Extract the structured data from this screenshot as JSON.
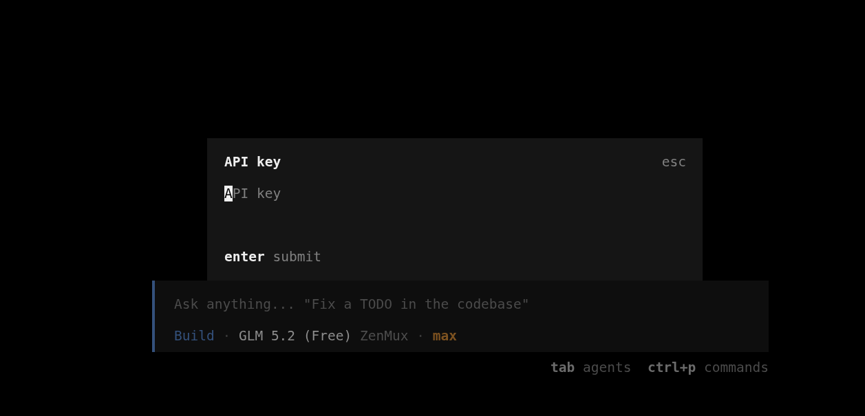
{
  "dialog": {
    "title": "API key",
    "close_hint": "esc",
    "field": {
      "placeholder": "API key",
      "focused": true
    },
    "hints": [
      {
        "key": "enter",
        "action": "submit"
      }
    ]
  },
  "prompt": {
    "placeholder": "Ask anything... \"Fix a TODO in the codebase\"",
    "status": [
      {
        "kind": "agent",
        "text": "Build"
      },
      {
        "kind": "separator",
        "text": "·"
      },
      {
        "kind": "model",
        "text": "GLM 5.2 (Free)"
      },
      {
        "kind": "provider",
        "text": "ZenMux"
      },
      {
        "kind": "separator",
        "text": "·"
      },
      {
        "kind": "variant",
        "text": "max"
      }
    ]
  },
  "footer_hints": [
    {
      "key": "tab",
      "action": "agents"
    },
    {
      "key": "ctrl+p",
      "action": "commands"
    }
  ]
}
